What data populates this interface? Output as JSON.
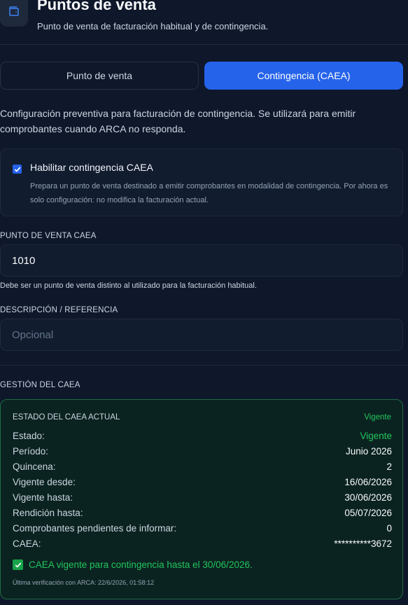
{
  "header": {
    "title": "Puntos de venta",
    "subtitle": "Punto de venta de facturación habitual y de contingencia.",
    "icon": "wallet-icon"
  },
  "tabs": [
    {
      "label": "Punto de venta",
      "active": false
    },
    {
      "label": "Contingencia (CAEA)",
      "active": true
    }
  ],
  "intro": "Configuración preventiva para facturación de contingencia. Se utilizará para emitir comprobantes cuando ARCA no responda.",
  "enable": {
    "checked": true,
    "label": "Habilitar contingencia CAEA",
    "help": "Prepara un punto de venta destinado a emitir comprobantes en modalidad de contingencia. Por ahora es solo configuración: no modifica la facturación actual."
  },
  "pv_caea": {
    "label": "PUNTO DE VENTA CAEA",
    "value": "1010",
    "help": "Debe ser un punto de venta distinto al utilizado para la facturación habitual."
  },
  "descripcion": {
    "label": "DESCRIPCIÓN / REFERENCIA",
    "placeholder": "Opcional"
  },
  "gestion": {
    "label": "GESTIÓN DEL CAEA",
    "card_title": "ESTADO DEL CAEA ACTUAL",
    "badge": "Vigente",
    "rows": [
      {
        "key": "Estado:",
        "value": "Vigente"
      },
      {
        "key": "Período:",
        "value": "Junio 2026"
      },
      {
        "key": "Quincena:",
        "value": "2"
      },
      {
        "key": "Vigente desde:",
        "value": "16/06/2026"
      },
      {
        "key": "Vigente hasta:",
        "value": "30/06/2026"
      },
      {
        "key": "Rendición hasta:",
        "value": "05/07/2026"
      },
      {
        "key": "Comprobantes pendientes de informar:",
        "value": "0"
      },
      {
        "key": "CAEA:",
        "value": "**********3672"
      }
    ],
    "ok_message": "CAEA vigente para contingencia hasta el 30/06/2026.",
    "last_check": "Última verificación con ARCA: 22/6/2026, 01:58:12"
  },
  "colors": {
    "accent": "#2563eb",
    "success": "#22c55e",
    "background": "#0f172a"
  }
}
